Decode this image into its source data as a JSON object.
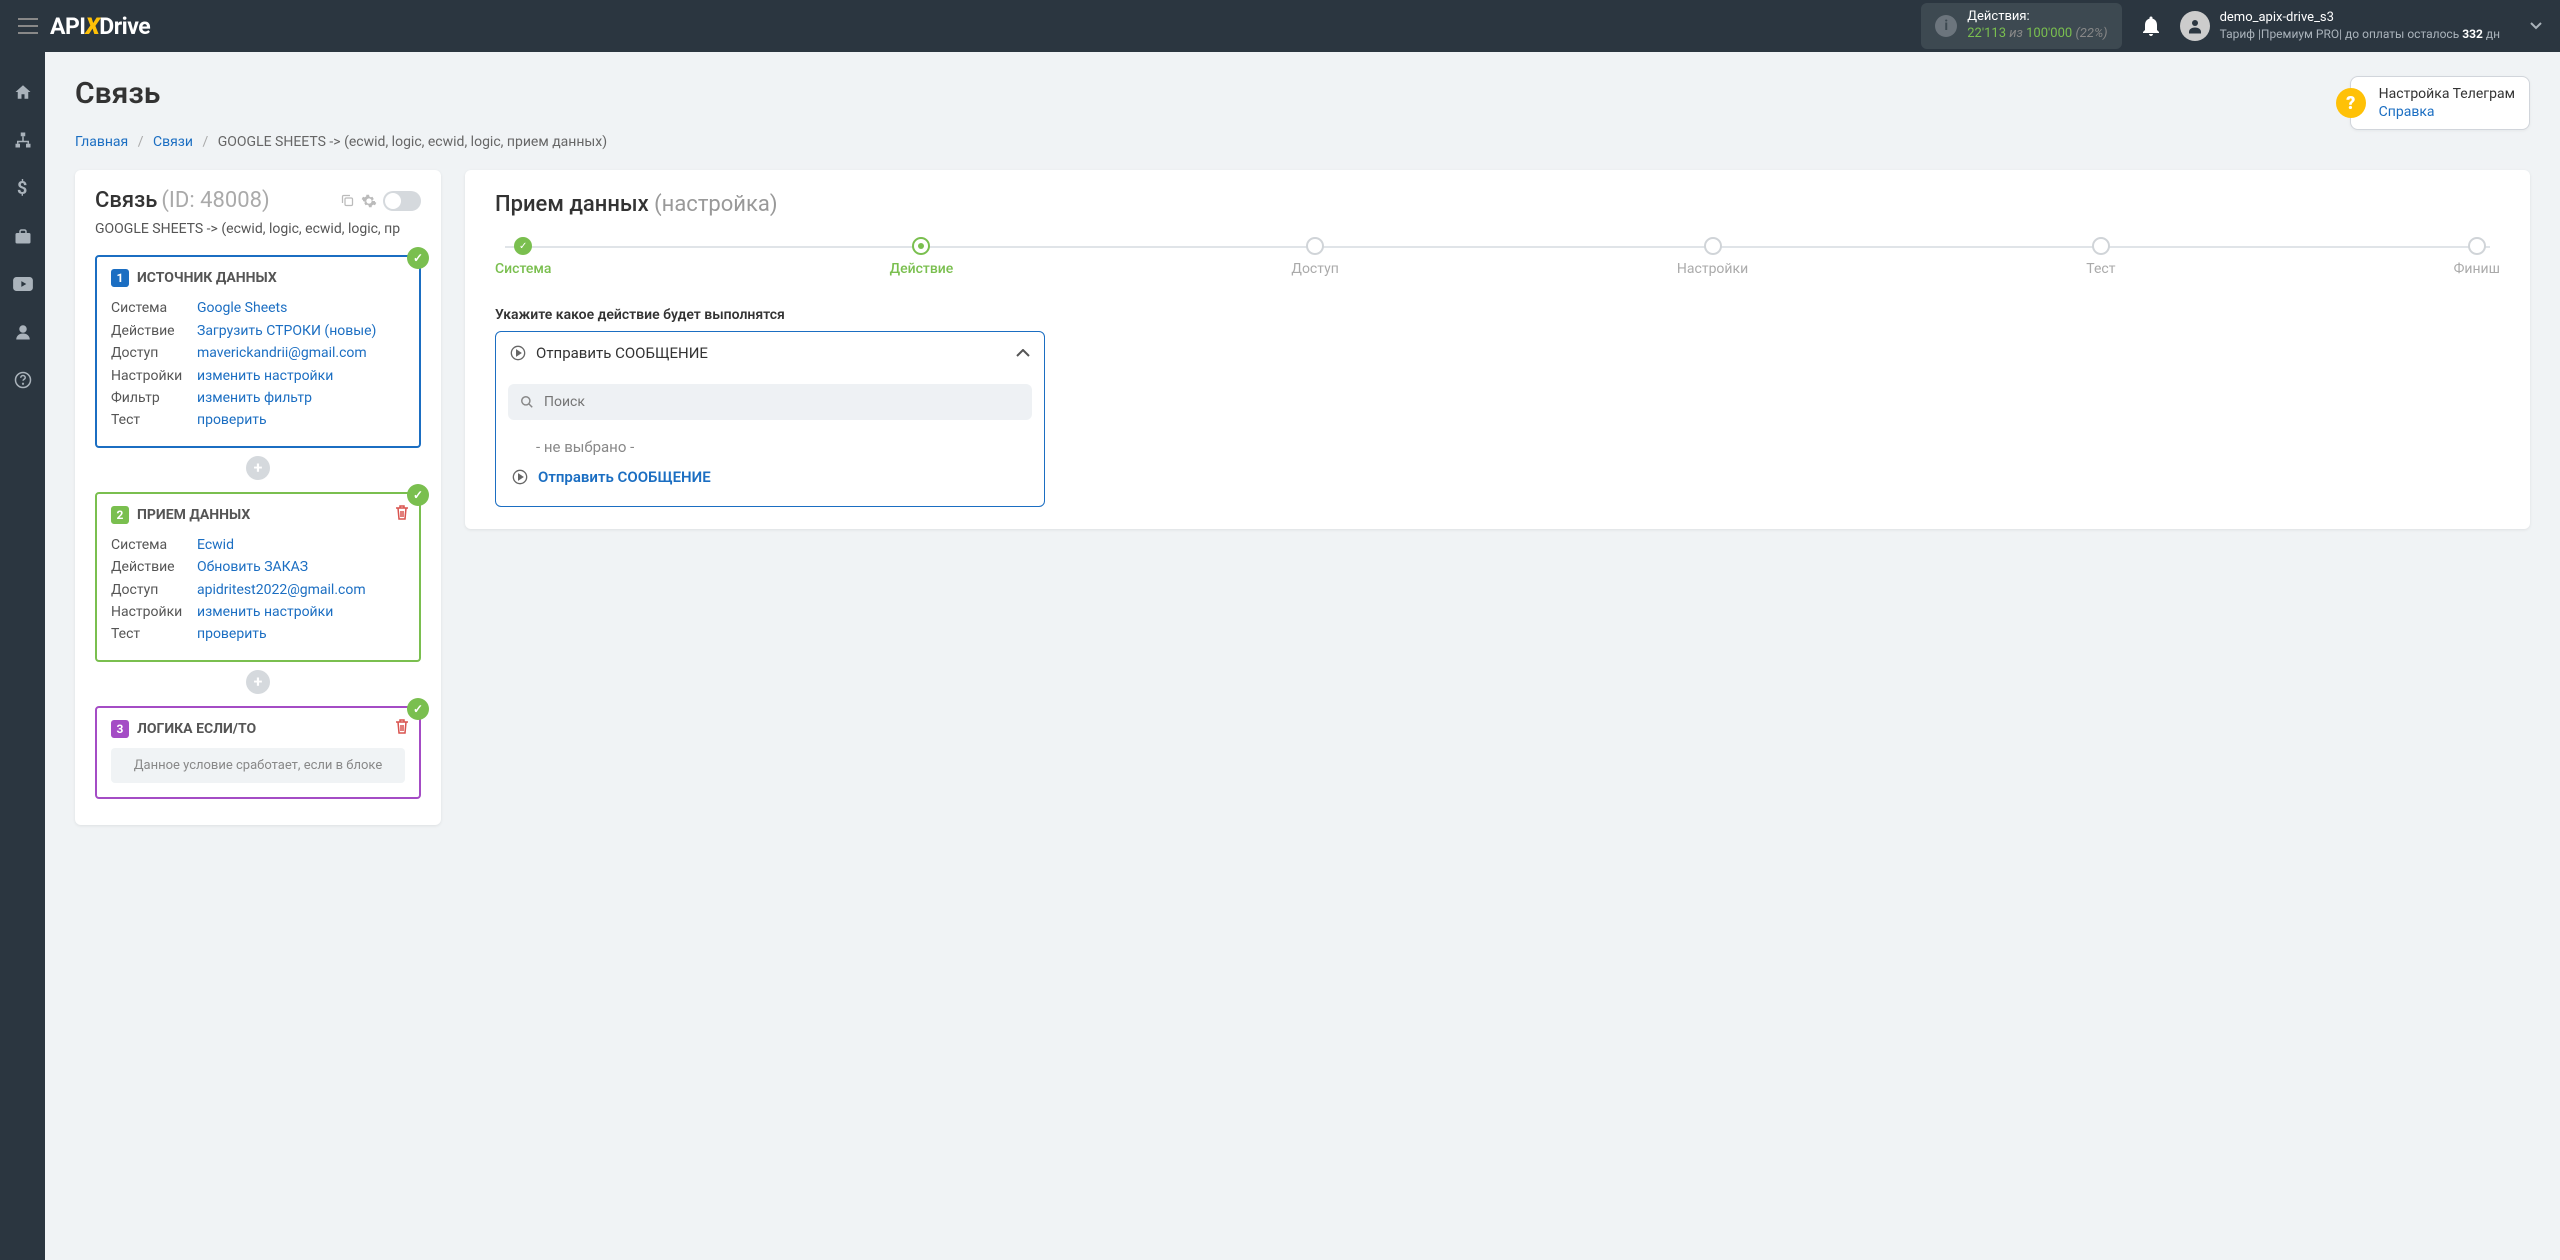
{
  "header": {
    "logo_a": "API",
    "logo_x": "X",
    "logo_b": "Drive",
    "actions_label": "Действия:",
    "actions_count": "22'113",
    "actions_of": " из ",
    "actions_total": "100'000",
    "actions_pct": "(22%)",
    "user_name": "demo_apix-drive_s3",
    "user_plan_prefix": "Тариф |Премиум PRO| до оплаты осталось ",
    "user_plan_days": "332",
    "user_plan_suffix": " дн"
  },
  "page": {
    "title": "Связь",
    "breadcrumb": {
      "home": "Главная",
      "connections": "Связи",
      "current": "GOOGLE SHEETS -> (ecwid, logic, ecwid, logic, прием данных)"
    },
    "help_title": "Настройка Телеграм",
    "help_link": "Справка"
  },
  "conn": {
    "title": "Связь",
    "id": "(ID: 48008)",
    "subtitle": "GOOGLE SHEETS -> (ecwid, logic, ecwid, logic, пр",
    "blocks": [
      {
        "num": "1",
        "title": "ИСТОЧНИК ДАННЫХ",
        "rows": [
          {
            "label": "Система",
            "value": "Google Sheets"
          },
          {
            "label": "Действие",
            "value": "Загрузить СТРОКИ (новые)"
          },
          {
            "label": "Доступ",
            "value": "maverickandrii@gmail.com"
          },
          {
            "label": "Настройки",
            "value": "изменить настройки"
          },
          {
            "label": "Фильтр",
            "value": "изменить фильтр"
          },
          {
            "label": "Тест",
            "value": "проверить"
          }
        ]
      },
      {
        "num": "2",
        "title": "ПРИЕМ ДАННЫХ",
        "rows": [
          {
            "label": "Система",
            "value": "Ecwid"
          },
          {
            "label": "Действие",
            "value": "Обновить ЗАКАЗ"
          },
          {
            "label": "Доступ",
            "value": "apidritest2022@gmail.com"
          },
          {
            "label": "Настройки",
            "value": "изменить настройки"
          },
          {
            "label": "Тест",
            "value": "проверить"
          }
        ]
      },
      {
        "num": "3",
        "title": "ЛОГИКА ЕСЛИ/ТО",
        "note": "Данное условие сработает, если в блоке"
      }
    ]
  },
  "right": {
    "title": "Прием данных",
    "subtitle": "(настройка)",
    "steps": [
      {
        "label": "Система",
        "state": "done"
      },
      {
        "label": "Действие",
        "state": "active"
      },
      {
        "label": "Доступ",
        "state": ""
      },
      {
        "label": "Настройки",
        "state": ""
      },
      {
        "label": "Тест",
        "state": ""
      },
      {
        "label": "Финиш",
        "state": ""
      }
    ],
    "form_label": "Укажите какое действие будет выполнятся",
    "select_value": "Отправить СООБЩЕНИЕ",
    "search_placeholder": "Поиск",
    "opt_none": "- не выбрано -",
    "opt_selected": "Отправить СООБЩЕНИЕ"
  }
}
